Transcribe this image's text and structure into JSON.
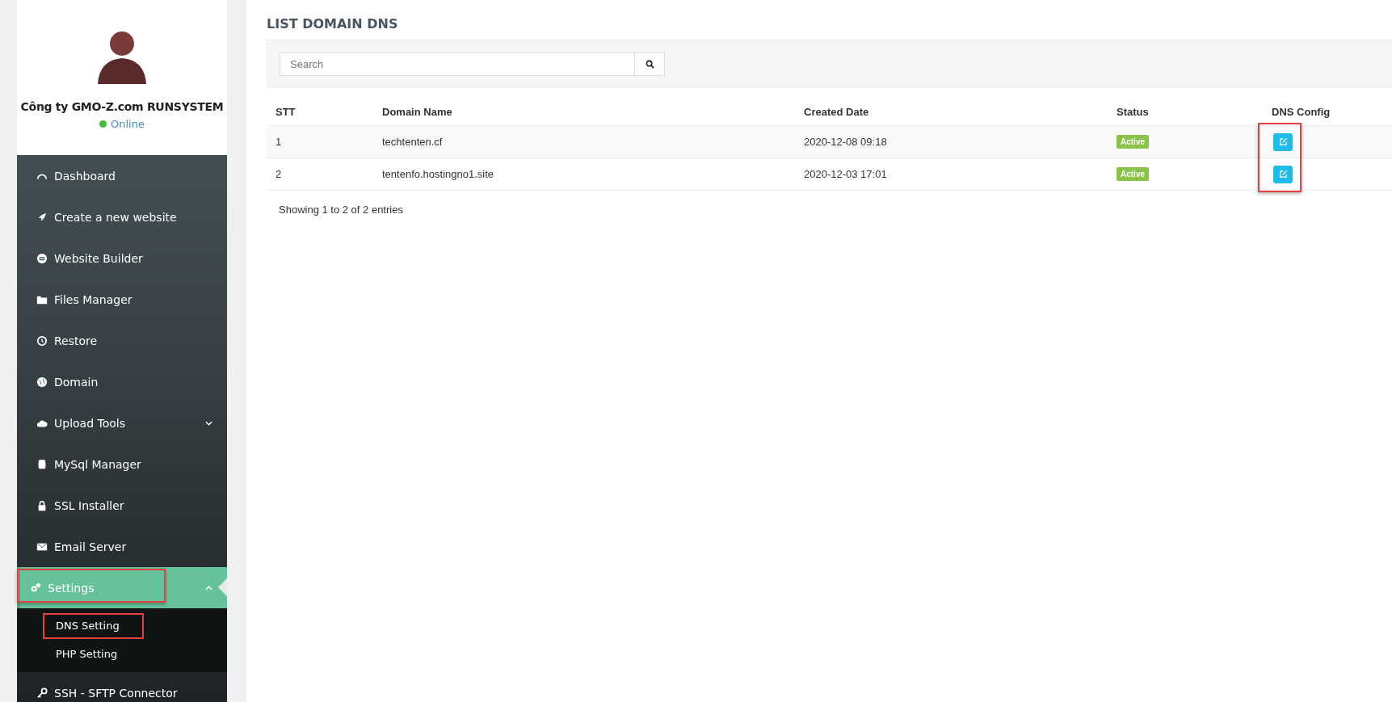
{
  "profile": {
    "name": "Công ty GMO-Z.com RUNSYSTEM",
    "status": "Online",
    "online": true
  },
  "menu": [
    {
      "label": "Dashboard",
      "selected": false
    },
    {
      "label": "Create a new website",
      "selected": false
    },
    {
      "label": "Website Builder",
      "selected": false
    },
    {
      "label": "Files Manager",
      "selected": false
    },
    {
      "label": "Restore",
      "selected": false
    },
    {
      "label": "Domain",
      "selected": false
    },
    {
      "label": "Upload Tools",
      "selected": false,
      "expanded": false
    },
    {
      "label": "MySql Manager",
      "selected": false
    },
    {
      "label": "SSL Installer",
      "selected": false
    },
    {
      "label": "Email Server",
      "selected": false
    },
    {
      "label": "Settings",
      "selected": true,
      "expanded": true,
      "highlighted": true,
      "children": [
        {
          "label": "DNS Setting",
          "highlighted": true
        },
        {
          "label": "PHP Setting",
          "highlighted": false
        }
      ]
    },
    {
      "label": "SSH - SFTP Connector",
      "selected": false
    }
  ],
  "page_title": "LIST DOMAIN DNS",
  "search": {
    "placeholder": "Search"
  },
  "table": {
    "columns": [
      "STT",
      "Domain Name",
      "Created Date",
      "Status",
      "DNS Config"
    ],
    "rows": [
      {
        "stt": "1",
        "domain": "techtenten.cf",
        "created": "2020-12-08 09:18",
        "status": "Active"
      },
      {
        "stt": "2",
        "domain": "tentenfo.hostingno1.site",
        "created": "2020-12-03 17:01",
        "status": "Active"
      }
    ],
    "config_highlighted": true
  },
  "footer": "Showing 1 to 2 of 2 entries"
}
